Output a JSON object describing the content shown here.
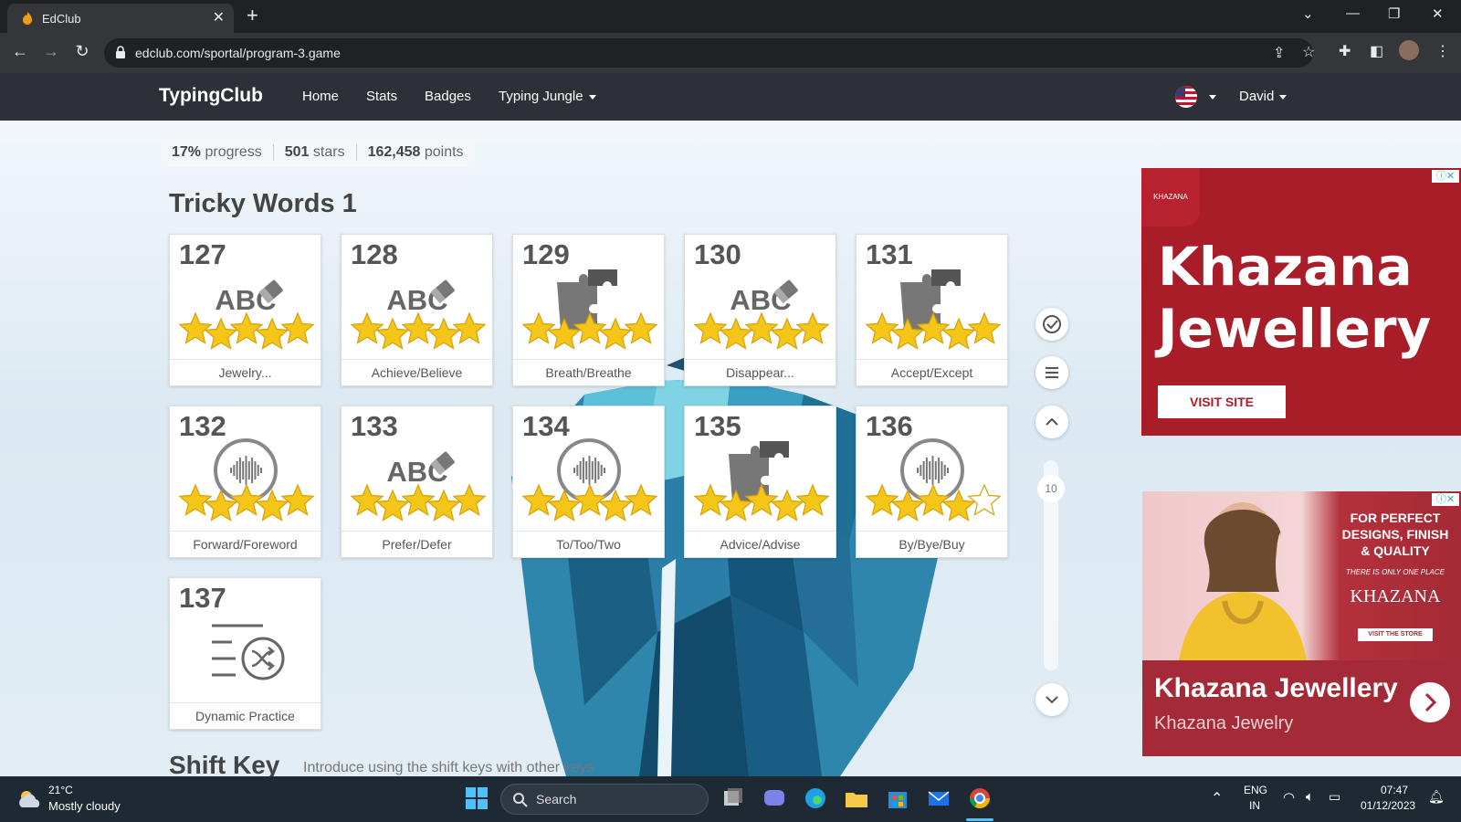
{
  "browser": {
    "tab_title": "EdClub",
    "url": "edclub.com/sportal/program-3.game"
  },
  "site": {
    "logo": "TypingClub",
    "nav": [
      "Home",
      "Stats",
      "Badges",
      "Typing Jungle"
    ],
    "user": "David"
  },
  "progress": {
    "percent": "17%",
    "percent_label": "progress",
    "stars": "501",
    "stars_label": "stars",
    "points": "162,458",
    "points_label": "points"
  },
  "section": {
    "title": "Tricky Words 1"
  },
  "lessons": [
    {
      "num": "127",
      "label": "Jewelry...",
      "icon": "abc-eraser-icon",
      "stars": 5
    },
    {
      "num": "128",
      "label": "Achieve/Believe",
      "icon": "abc-eraser-icon",
      "stars": 5
    },
    {
      "num": "129",
      "label": "Breath/Breathe",
      "icon": "puzzle-icon",
      "stars": 5
    },
    {
      "num": "130",
      "label": "Disappear...",
      "icon": "abc-eraser-icon",
      "stars": 5
    },
    {
      "num": "131",
      "label": "Accept/Except",
      "icon": "puzzle-icon",
      "stars": 5
    },
    {
      "num": "132",
      "label": "Forward/Foreword",
      "icon": "audio-icon",
      "stars": 5
    },
    {
      "num": "133",
      "label": "Prefer/Defer",
      "icon": "abc-eraser-icon",
      "stars": 5
    },
    {
      "num": "134",
      "label": "To/Too/Two",
      "icon": "audio-icon",
      "stars": 5
    },
    {
      "num": "135",
      "label": "Advice/Advise",
      "icon": "puzzle-icon",
      "stars": 5
    },
    {
      "num": "136",
      "label": "By/Bye/Buy",
      "icon": "audio-icon",
      "stars": 4
    },
    {
      "num": "137",
      "label": "Dynamic Practice",
      "icon": "shuffle-list-icon",
      "stars": 0
    }
  ],
  "scroll_indicator": "10",
  "next_section": {
    "title": "Shift Key",
    "desc": "Introduce using the shift keys with other keys"
  },
  "ads": {
    "ad1": {
      "brand": "KHAZANA",
      "headline_1": "Khazana",
      "headline_2": "Jewellery",
      "cta": "VISIT SITE"
    },
    "ad2": {
      "tagline": "FOR PERFECT DESIGNS, FINISH & QUALITY",
      "small": "THERE IS ONLY ONE PLACE",
      "logo": "KHAZANA",
      "store": "VISIT THE STORE",
      "title": "Khazana Jewellery",
      "subtitle": "Khazana Jewelry"
    }
  },
  "taskbar": {
    "temp": "21°C",
    "weather": "Mostly cloudy",
    "search": "Search",
    "lang1": "ENG",
    "lang2": "IN",
    "time": "07:47",
    "date": "01/12/2023"
  },
  "colors": {
    "star": "#f5c518",
    "ad_red": "#a91d29",
    "nav_bg": "#2d3036"
  }
}
